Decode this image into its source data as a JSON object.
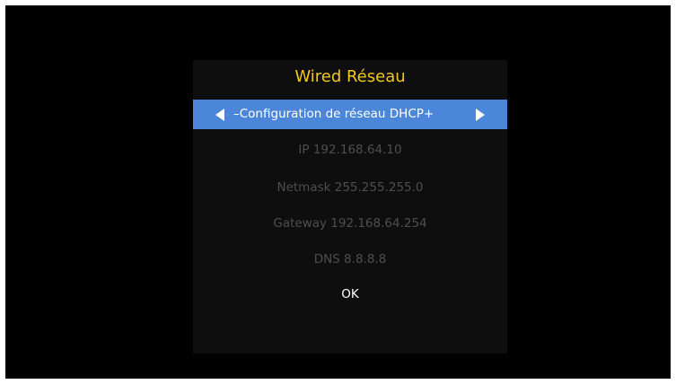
{
  "dialog": {
    "title": "Wired Réseau",
    "selector": {
      "label": "–Configuration de réseau DHCP+",
      "left_arrow_icon": "triangle-left-icon",
      "right_arrow_icon": "triangle-right-icon"
    },
    "fields": {
      "ip": "IP 192.168.64.10",
      "netmask": "Netmask 255.255.255.0",
      "gateway": "Gateway 192.168.64.254",
      "dns": "DNS 8.8.8.8"
    },
    "ok_label": "OK"
  },
  "colors": {
    "background": "#000000",
    "dialog": "#0e0e0e",
    "title": "#f2c81a",
    "selector_highlight": "#4b86d8",
    "disabled_text": "#4e4e4e",
    "active_text": "#ffffff"
  }
}
